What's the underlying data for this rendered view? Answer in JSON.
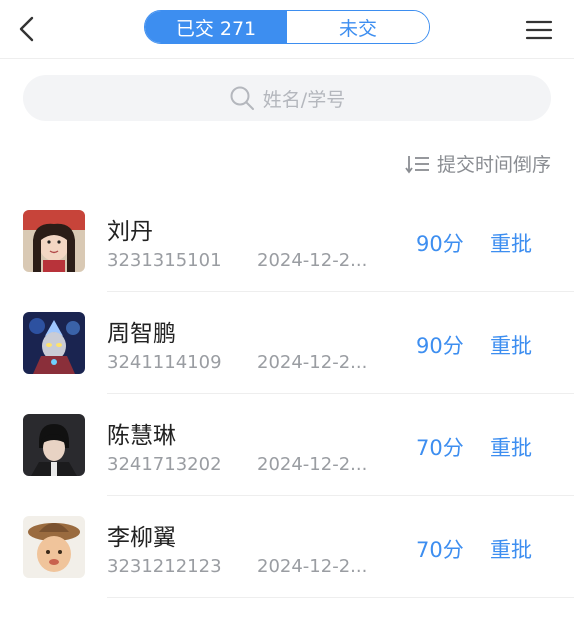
{
  "header": {
    "back_icon": "chevron-left-icon",
    "tabs": [
      {
        "label": "已交 271",
        "active": true
      },
      {
        "label": "未交",
        "active": false
      }
    ],
    "menu_icon": "hamburger-menu-icon"
  },
  "search": {
    "icon": "search-icon",
    "placeholder": "姓名/学号"
  },
  "sort": {
    "icon": "sort-descending-icon",
    "label": "提交时间倒序"
  },
  "students": [
    {
      "name": "刘丹",
      "id": "3231315101",
      "date": "2024-12-2...",
      "score": "90分",
      "action": "重批"
    },
    {
      "name": "周智鹏",
      "id": "3241114109",
      "date": "2024-12-2...",
      "score": "90分",
      "action": "重批"
    },
    {
      "name": "陈慧琳",
      "id": "3241713202",
      "date": "2024-12-2...",
      "score": "70分",
      "action": "重批"
    },
    {
      "name": "李柳翼",
      "id": "3231212123",
      "date": "2024-12-2...",
      "score": "70分",
      "action": "重批"
    }
  ],
  "colors": {
    "accent": "#3d8ef0",
    "muted_text": "#9a9da2",
    "search_bg": "#f3f4f6"
  }
}
